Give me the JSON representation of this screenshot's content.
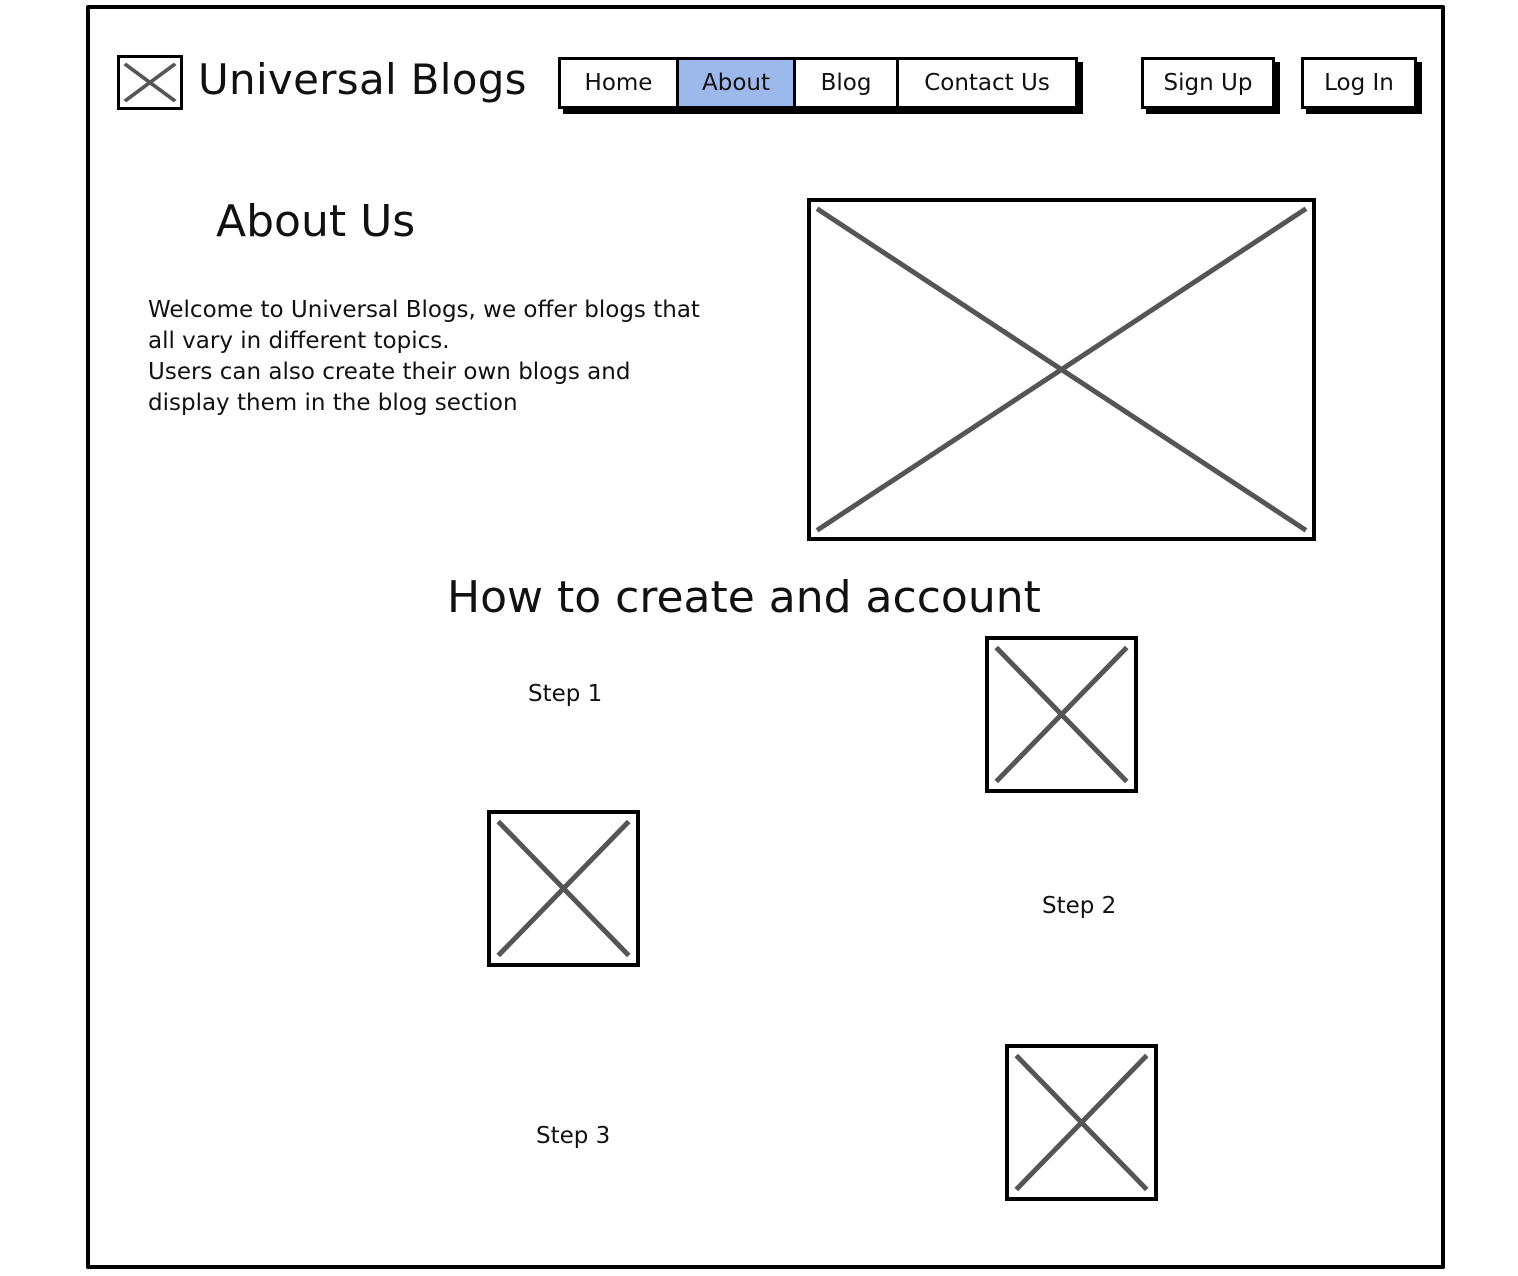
{
  "header": {
    "site_title": "Universal Blogs",
    "logo_icon": "image-placeholder-icon"
  },
  "nav": {
    "items": [
      {
        "label": "Home",
        "active": false
      },
      {
        "label": "About",
        "active": true
      },
      {
        "label": "Blog",
        "active": false
      },
      {
        "label": "Contact Us",
        "active": false
      }
    ],
    "active_color": "#9db9ec"
  },
  "auth": {
    "signup_label": "Sign Up",
    "login_label": "Log In"
  },
  "about": {
    "heading": "About Us",
    "paragraphs": [
      "Welcome to Universal Blogs, we offer blogs that all vary in different topics.",
      "Users can also create their own blogs and display them in the blog section"
    ],
    "image_icon": "image-placeholder-icon"
  },
  "howto": {
    "heading": "How to create and account",
    "steps": [
      {
        "label": "Step 1",
        "image_icon": "image-placeholder-icon"
      },
      {
        "label": "Step 2",
        "image_icon": "image-placeholder-icon"
      },
      {
        "label": "Step 3",
        "image_icon": "image-placeholder-icon"
      }
    ]
  }
}
